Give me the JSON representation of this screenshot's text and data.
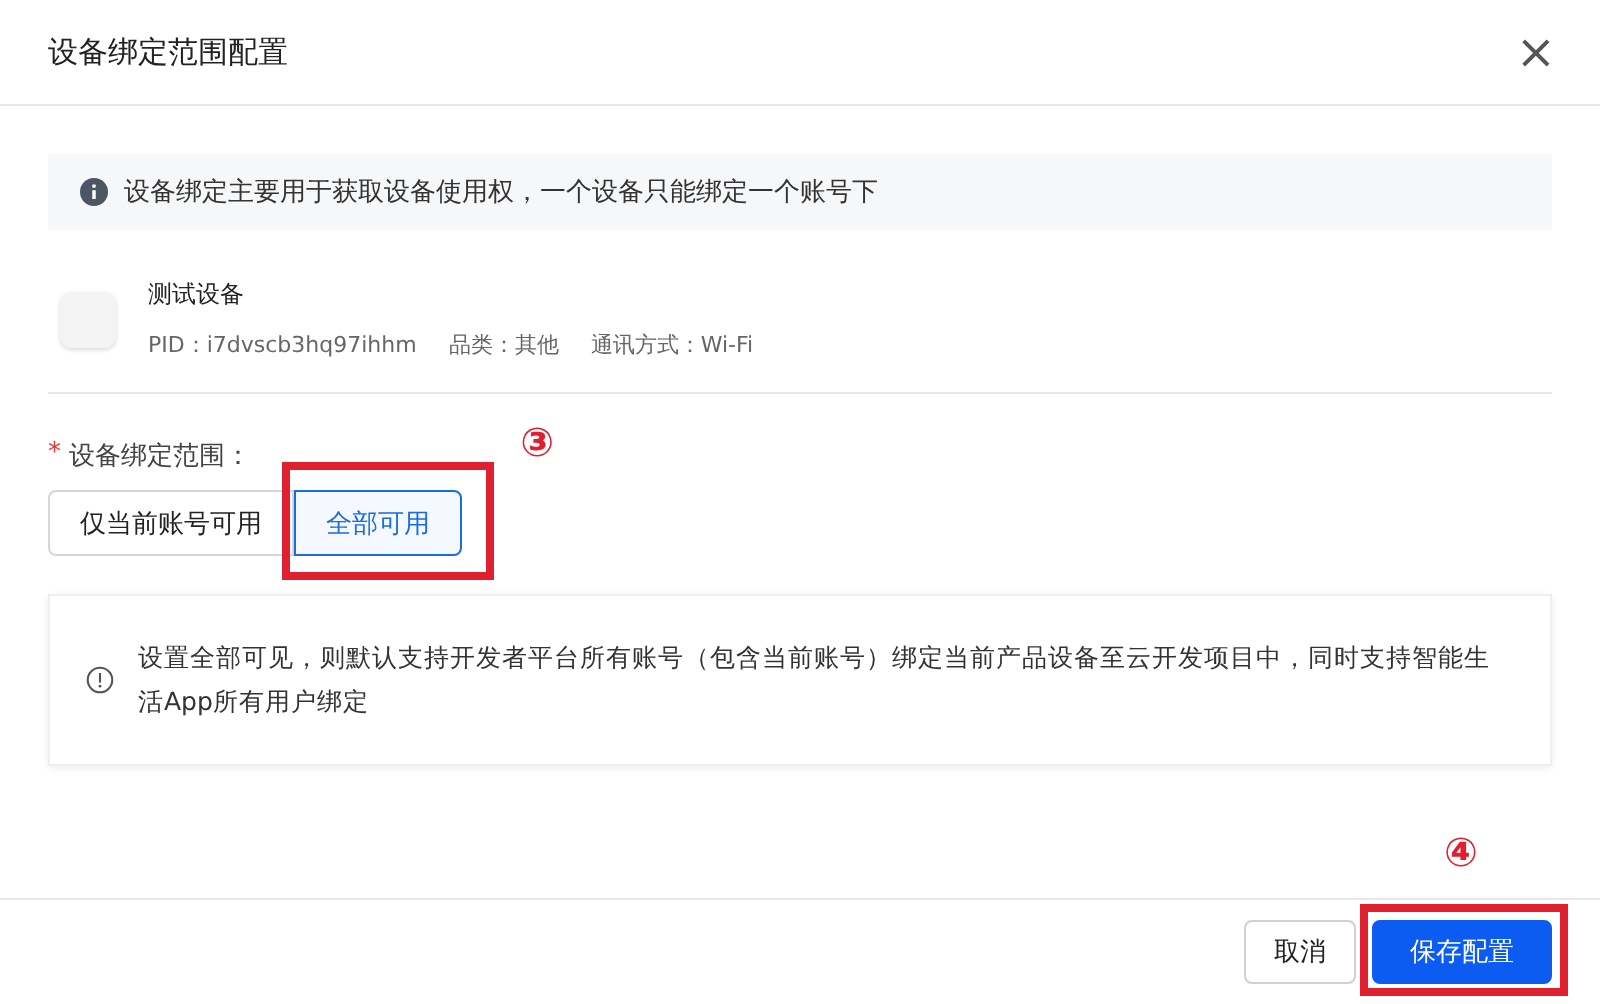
{
  "dialog": {
    "title": "设备绑定范围配置",
    "close": "×"
  },
  "notice": "设备绑定主要用于获取设备使用权，一个设备只能绑定一个账号下",
  "device": {
    "name": "测试设备",
    "meta": [
      {
        "label": "PID：",
        "value": "i7dvscb3hq97ihhm"
      },
      {
        "label": "品类：",
        "value": "其他"
      },
      {
        "label": "通讯方式：",
        "value": "Wi-Fi"
      }
    ]
  },
  "scope": {
    "required_mark": "*",
    "label": "设备绑定范围：",
    "options": [
      {
        "label": "仅当前账号可用",
        "selected": false
      },
      {
        "label": "全部可用",
        "selected": true,
        "annotation": "③"
      }
    ]
  },
  "hint": "设置全部可见，则默认支持开发者平台所有账号（包含当前账号）绑定当前产品设备至云开发项目中，同时支持智能生活App所有用户绑定",
  "buttons": [
    {
      "label": "取消",
      "kind": "secondary"
    },
    {
      "label": "保存配置",
      "kind": "primary",
      "annotation": "④"
    }
  ]
}
